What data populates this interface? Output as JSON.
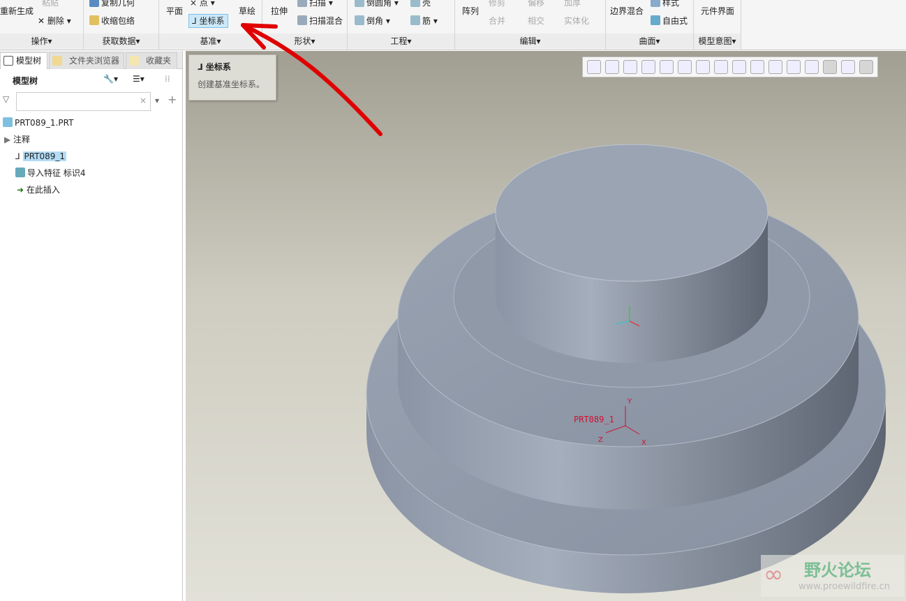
{
  "ribbon": {
    "groups": [
      {
        "label": "操作▾",
        "items": [
          "重新生成",
          "粘贴",
          "删除"
        ]
      },
      {
        "label": "获取数据▾",
        "items": [
          "复制几何",
          "收缩包络"
        ]
      },
      {
        "label": "基准▾",
        "items": [
          "平面",
          "点",
          "坐标系",
          "草绘"
        ]
      },
      {
        "label": "形状▾",
        "items": [
          "拉伸",
          "扫描",
          "扫描混合"
        ]
      },
      {
        "label": "工程▾",
        "items": [
          "倒圆角",
          "倒角",
          "壳",
          "筋"
        ]
      },
      {
        "label": "编辑▾",
        "items": [
          "阵列",
          "修剪",
          "偏移",
          "加厚",
          "合并",
          "相交",
          "实体化"
        ]
      },
      {
        "label": "曲面▾",
        "items": [
          "边界混合",
          "样式",
          "自由式"
        ]
      },
      {
        "label": "模型意图▾",
        "items": [
          "元件界面"
        ]
      }
    ]
  },
  "tooltip": {
    "title": "坐标系",
    "desc": "创建基准坐标系。"
  },
  "left": {
    "tabs": [
      "模型树",
      "文件夹浏览器",
      "收藏夹"
    ],
    "title": "模型树",
    "filter_placeholder": "",
    "tree": [
      "PRT089_1.PRT",
      "注释",
      "PRT089_1",
      "导入特征 标识4",
      "在此插入"
    ]
  },
  "viewport": {
    "csys_label": "PRT089_1",
    "axes": [
      "Y",
      "Z",
      "X"
    ]
  },
  "watermark": {
    "title": "野火论坛",
    "url": "www.proewildfire.cn"
  },
  "colors": {
    "accent": "#cce8f8",
    "arrow": "#e00000",
    "model": "#95a0b0"
  }
}
